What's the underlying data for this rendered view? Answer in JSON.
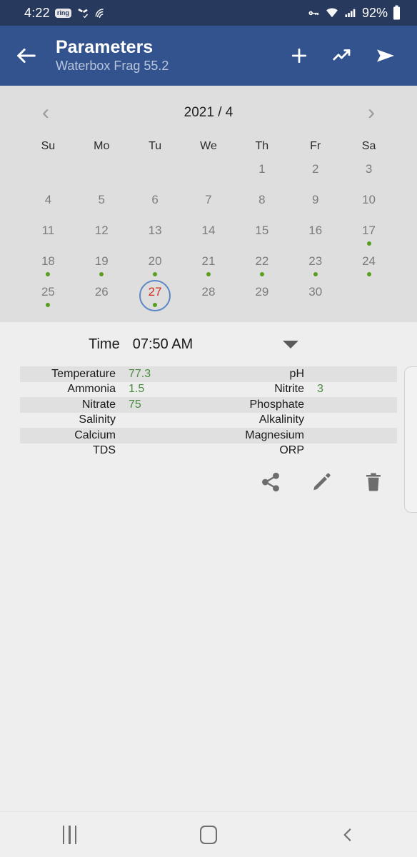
{
  "statusbar": {
    "time": "4:22",
    "ring_badge": "ring",
    "sync_icon": "sync-check-icon",
    "cast_icon": "wifi-arc-icon",
    "vpn_icon": "vpn-key-icon",
    "wifi_icon": "wifi-icon",
    "signal_icon": "cell-signal-icon",
    "battery_percent": "92%",
    "battery_icon": "battery-icon"
  },
  "appbar": {
    "back_icon": "back-arrow-icon",
    "title": "Parameters",
    "subtitle": "Waterbox Frag 55.2",
    "add_icon": "plus-icon",
    "chart_icon": "trending-up-icon",
    "send_icon": "send-icon",
    "background": "#33538f"
  },
  "calendar": {
    "prev_label": "‹",
    "next_label": "›",
    "title": "2021 / 4",
    "weekdays": [
      "Su",
      "Mo",
      "Tu",
      "We",
      "Th",
      "Fr",
      "Sa"
    ],
    "lead_blanks": 4,
    "days": [
      {
        "n": "1",
        "dot": false,
        "selected": false
      },
      {
        "n": "2",
        "dot": false,
        "selected": false
      },
      {
        "n": "3",
        "dot": false,
        "selected": false
      },
      {
        "n": "4",
        "dot": false,
        "selected": false
      },
      {
        "n": "5",
        "dot": false,
        "selected": false
      },
      {
        "n": "6",
        "dot": false,
        "selected": false
      },
      {
        "n": "7",
        "dot": false,
        "selected": false
      },
      {
        "n": "8",
        "dot": false,
        "selected": false
      },
      {
        "n": "9",
        "dot": false,
        "selected": false
      },
      {
        "n": "10",
        "dot": false,
        "selected": false
      },
      {
        "n": "11",
        "dot": false,
        "selected": false
      },
      {
        "n": "12",
        "dot": false,
        "selected": false
      },
      {
        "n": "13",
        "dot": false,
        "selected": false
      },
      {
        "n": "14",
        "dot": false,
        "selected": false
      },
      {
        "n": "15",
        "dot": false,
        "selected": false
      },
      {
        "n": "16",
        "dot": false,
        "selected": false
      },
      {
        "n": "17",
        "dot": true,
        "selected": false
      },
      {
        "n": "18",
        "dot": true,
        "selected": false
      },
      {
        "n": "19",
        "dot": true,
        "selected": false
      },
      {
        "n": "20",
        "dot": true,
        "selected": false
      },
      {
        "n": "21",
        "dot": true,
        "selected": false
      },
      {
        "n": "22",
        "dot": true,
        "selected": false
      },
      {
        "n": "23",
        "dot": true,
        "selected": false
      },
      {
        "n": "24",
        "dot": true,
        "selected": false
      },
      {
        "n": "25",
        "dot": true,
        "selected": false
      },
      {
        "n": "26",
        "dot": false,
        "selected": false
      },
      {
        "n": "27",
        "dot": true,
        "selected": true
      },
      {
        "n": "28",
        "dot": false,
        "selected": false
      },
      {
        "n": "29",
        "dot": false,
        "selected": false
      },
      {
        "n": "30",
        "dot": false,
        "selected": false
      }
    ],
    "selected_color": "#d42b1e",
    "ring_color": "#5b87c4",
    "dot_color": "#5a9e1f"
  },
  "time_row": {
    "label": "Time",
    "value": "07:50 AM",
    "dropdown_icon": "caret-down-icon"
  },
  "parameters": {
    "value_color": "#4a8c3f",
    "rows": [
      {
        "left_label": "Temperature",
        "left_value": "77.3",
        "right_label": "pH",
        "right_value": ""
      },
      {
        "left_label": "Ammonia",
        "left_value": "1.5",
        "right_label": "Nitrite",
        "right_value": "3"
      },
      {
        "left_label": "Nitrate",
        "left_value": "75",
        "right_label": "Phosphate",
        "right_value": ""
      },
      {
        "left_label": "Salinity",
        "left_value": "",
        "right_label": "Alkalinity",
        "right_value": ""
      },
      {
        "left_label": "Calcium",
        "left_value": "",
        "right_label": "Magnesium",
        "right_value": ""
      },
      {
        "left_label": "TDS",
        "left_value": "",
        "right_label": "ORP",
        "right_value": ""
      }
    ]
  },
  "row_actions": {
    "share_icon": "share-icon",
    "edit_icon": "pencil-icon",
    "delete_icon": "trash-icon"
  },
  "navbar": {
    "recents_icon": "recents-icon",
    "home_icon": "home-icon",
    "back_icon": "nav-back-icon"
  }
}
